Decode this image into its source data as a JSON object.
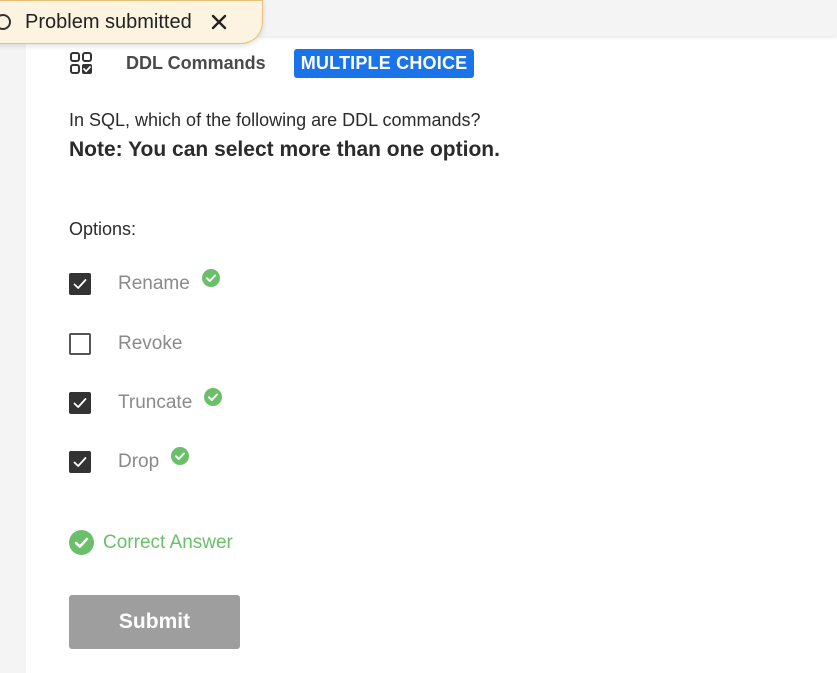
{
  "toast": {
    "message": "Problem submitted",
    "close_icon": "close-icon",
    "status_icon": "circle-icon",
    "bg_color": "#fdf3e1",
    "border_color": "#e9c07a"
  },
  "header": {
    "icon": "grid-check-icon",
    "title": "DDL Commands",
    "type_badge": "MULTIPLE CHOICE",
    "badge_color": "#1a73e8"
  },
  "question": {
    "text": "In SQL, which of the following are DDL commands?",
    "note": "Note: You can select more than one option."
  },
  "options_label": "Options:",
  "options": [
    {
      "label": "Rename",
      "checked": true,
      "correct": true
    },
    {
      "label": "Revoke",
      "checked": false,
      "correct": false
    },
    {
      "label": "Truncate",
      "checked": true,
      "correct": true
    },
    {
      "label": "Drop",
      "checked": true,
      "correct": true
    }
  ],
  "result": {
    "text": "Correct Answer",
    "icon": "check-circle-icon",
    "color": "#6abf69"
  },
  "submit": {
    "label": "Submit",
    "color": "#9e9e9e"
  }
}
